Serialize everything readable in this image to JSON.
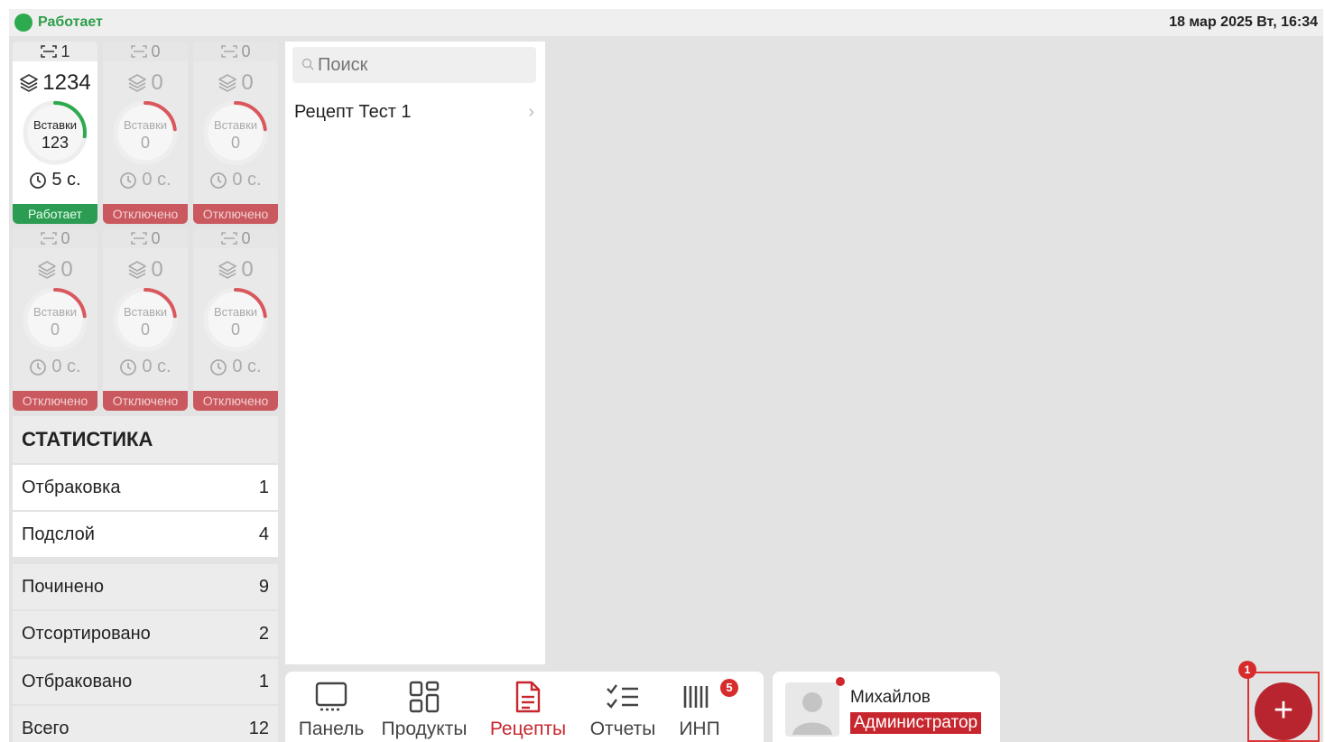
{
  "statusbar": {
    "status": "Работает",
    "datetime": "18 мар 2025 Вт, 16:34",
    "status_color": "#2eaa4e"
  },
  "stations": [
    {
      "top_count": "1",
      "count": "1234",
      "gauge_label": "Вставки",
      "gauge_value": "123",
      "time": "5 с.",
      "status": "Работает",
      "active": true
    },
    {
      "top_count": "0",
      "count": "0",
      "gauge_label": "Вставки",
      "gauge_value": "0",
      "time": "0 с.",
      "status": "Отключено",
      "active": false
    },
    {
      "top_count": "0",
      "count": "0",
      "gauge_label": "Вставки",
      "gauge_value": "0",
      "time": "0 с.",
      "status": "Отключено",
      "active": false
    },
    {
      "top_count": "0",
      "count": "0",
      "gauge_label": "Вставки",
      "gauge_value": "0",
      "time": "0 с.",
      "status": "Отключено",
      "active": false
    },
    {
      "top_count": "0",
      "count": "0",
      "gauge_label": "Вставки",
      "gauge_value": "0",
      "time": "0 с.",
      "status": "Отключено",
      "active": false
    },
    {
      "top_count": "0",
      "count": "0",
      "gauge_label": "Вставки",
      "gauge_value": "0",
      "time": "0 с.",
      "status": "Отключено",
      "active": false
    }
  ],
  "statistics": {
    "title": "СТАТИСТИКА",
    "rows": [
      {
        "label": "Отбраковка",
        "value": "1"
      },
      {
        "label": "Подслой",
        "value": "4"
      },
      {
        "label": "Починено",
        "value": "9"
      },
      {
        "label": "Отсортировано",
        "value": "2"
      },
      {
        "label": "Отбраковано",
        "value": "1"
      },
      {
        "label": "Всего",
        "value": "12"
      }
    ]
  },
  "recipes": {
    "search_placeholder": "Поиск",
    "items": [
      {
        "label": "Рецепт Тест 1"
      }
    ]
  },
  "nav": {
    "items": [
      {
        "label": "Панель",
        "icon": "monitor-icon"
      },
      {
        "label": "Продукты",
        "icon": "grid-icon"
      },
      {
        "label": "Рецепты",
        "icon": "document-icon",
        "active": true
      },
      {
        "label": "Отчеты",
        "icon": "checklist-icon"
      },
      {
        "label": "ИНП",
        "icon": "barcode-icon",
        "badge": "5"
      }
    ],
    "active_color": "#c7262e"
  },
  "user": {
    "name": "Михайлов",
    "role": "Администратор"
  },
  "fab": {
    "label": "+",
    "badge": "1"
  }
}
